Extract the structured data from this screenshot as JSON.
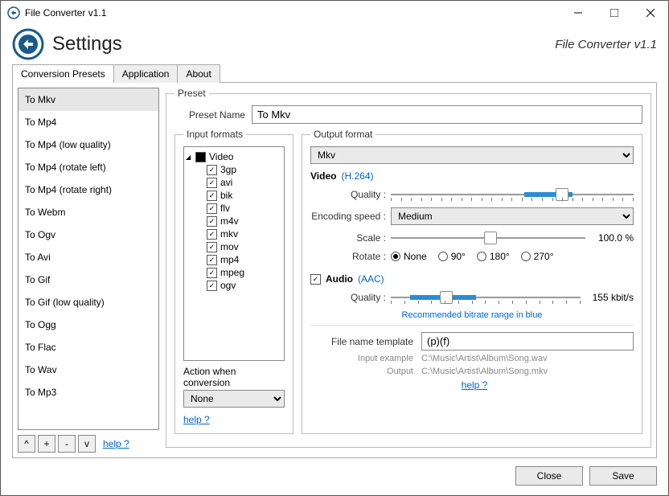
{
  "window": {
    "title": "File Converter v1.1"
  },
  "header": {
    "title": "Settings",
    "subtitle": "File Converter v1.1"
  },
  "tabs": {
    "t0": "Conversion Presets",
    "t1": "Application",
    "t2": "About"
  },
  "presets": {
    "items": [
      "To Mkv",
      "To Mp4",
      "To Mp4 (low quality)",
      "To Mp4 (rotate left)",
      "To Mp4 (rotate right)",
      "To Webm",
      "To Ogv",
      "To Avi",
      "To Gif",
      "To Gif (low quality)",
      "To Ogg",
      "To Flac",
      "To Wav",
      "To Mp3"
    ],
    "buttons": {
      "up": "^",
      "add": "+",
      "remove": "-",
      "down": "v"
    },
    "help": "help ?"
  },
  "preset_panel": {
    "legend": "Preset",
    "name_label": "Preset Name",
    "name_value": "To Mkv"
  },
  "inputs": {
    "legend": "Input formats",
    "group": "Video",
    "formats": [
      "3gp",
      "avi",
      "bik",
      "flv",
      "m4v",
      "mkv",
      "mov",
      "mp4",
      "mpeg",
      "ogv"
    ],
    "action_label": "Action when conversion",
    "action_value": "None",
    "help": "help ?"
  },
  "output": {
    "legend": "Output format",
    "format": "Mkv",
    "video": {
      "title": "Video",
      "codec": "(H.264)",
      "quality_label": "Quality :",
      "enc_label": "Encoding speed :",
      "enc_value": "Medium",
      "scale_label": "Scale :",
      "scale_value": "100.0 %",
      "rotate_label": "Rotate :",
      "rotate_opts": [
        "None",
        "90°",
        "180°",
        "270°"
      ]
    },
    "audio": {
      "title": "Audio",
      "codec": "(AAC)",
      "quality_label": "Quality :",
      "quality_value": "155 kbit/s",
      "reco": "Recommended bitrate range in blue"
    },
    "fnt": {
      "label": "File name template",
      "value": "(p)(f)",
      "in_label": "Input example",
      "in_value": "C:\\Music\\Artist\\Album\\Song.wav",
      "out_label": "Output",
      "out_value": "C:\\Music\\Artist\\Album\\Song.mkv"
    },
    "help": "help ?"
  },
  "footer": {
    "close": "Close",
    "save": "Save"
  }
}
